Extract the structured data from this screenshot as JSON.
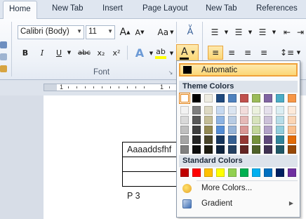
{
  "tabs": [
    "Home",
    "New Tab",
    "Insert",
    "Page Layout",
    "New Tab",
    "References"
  ],
  "font": {
    "name": "Calibri (Body)",
    "size": "11",
    "grow_label": "A",
    "shrink_label": "A",
    "case_label": "Aa",
    "bold": "B",
    "italic": "I",
    "underline": "U",
    "strikethrough": "abc",
    "subscript": "x₂",
    "superscript": "x²",
    "text_effects": "A",
    "highlight": "ab",
    "font_color": "A",
    "group_label": "Font"
  },
  "dropdown": {
    "automatic": "Automatic",
    "theme_title": "Theme Colors",
    "standard_title": "Standard Colors",
    "more_colors": "More Colors...",
    "gradient": "Gradient",
    "theme_top": [
      "#ffffff",
      "#000000",
      "#eeece1",
      "#1f497d",
      "#4f81bd",
      "#c0504d",
      "#9bbb59",
      "#8064a2",
      "#4bacc6",
      "#f79646"
    ],
    "theme_shades": [
      [
        "#f2f2f2",
        "#d9d9d9",
        "#bfbfbf",
        "#a6a6a6",
        "#808080"
      ],
      [
        "#7f7f7f",
        "#595959",
        "#404040",
        "#262626",
        "#0d0d0d"
      ],
      [
        "#ddd9c3",
        "#c4bd97",
        "#938953",
        "#4a452a",
        "#1d1b10"
      ],
      [
        "#c6d9f0",
        "#8db3e2",
        "#548dd4",
        "#17365d",
        "#0f243e"
      ],
      [
        "#dbe5f1",
        "#b8cce4",
        "#95b3d7",
        "#366092",
        "#244061"
      ],
      [
        "#f2dcdb",
        "#e5b9b7",
        "#d99694",
        "#953734",
        "#632423"
      ],
      [
        "#ebf1dd",
        "#d7e3bc",
        "#c3d69b",
        "#76923c",
        "#4f6128"
      ],
      [
        "#e5e0ec",
        "#ccc1d9",
        "#b2a2c7",
        "#5f497a",
        "#3f3151"
      ],
      [
        "#dbeef3",
        "#b7dde8",
        "#92cddc",
        "#31859b",
        "#205867"
      ],
      [
        "#fdeada",
        "#fbd5b5",
        "#fac08f",
        "#e36c09",
        "#974806"
      ]
    ],
    "standard": [
      "#c00000",
      "#ff0000",
      "#ffc000",
      "#ffff00",
      "#92d050",
      "#00b050",
      "#00b0f0",
      "#0070c0",
      "#002060",
      "#7030a0"
    ]
  },
  "document": {
    "table_cell_1": "Aaaaddsfhf",
    "paragraph": "P 3"
  },
  "ruler": {
    "numbers": [
      "1",
      "1"
    ]
  }
}
